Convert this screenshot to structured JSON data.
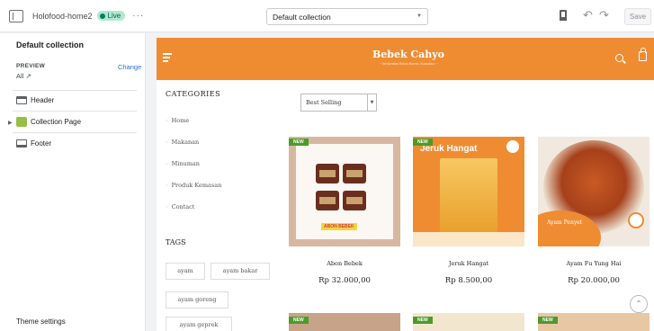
{
  "topbar": {
    "theme_name": "Holofood-home2",
    "live_label": "Live",
    "more": "···",
    "collection_select": "Default collection",
    "save_label": "Save"
  },
  "sidebar": {
    "title": "Default collection",
    "preview_label": "PREVIEW",
    "change_label": "Change",
    "preview_value": "All",
    "items": [
      {
        "label": "Header",
        "icon": "header-section-icon"
      },
      {
        "label": "Collection Page",
        "icon": "collection-page-icon"
      },
      {
        "label": "Footer",
        "icon": "footer-section-icon"
      }
    ],
    "theme_settings": "Theme settings"
  },
  "store": {
    "logo": "Bebek Cahyo",
    "tagline": "~ Kenikmatan Bebek Bumbu Nusantara ~",
    "header_color": "#ef8c32",
    "categories_title": "CATEGORIES",
    "categories": [
      "Home",
      "Makanan",
      "Minuman",
      "Produk Kemasan",
      "Contact"
    ],
    "tags_title": "TAGS",
    "tags": [
      "ayam",
      "ayam bakar",
      "ayam goreng",
      "ayam geprek"
    ],
    "sort_value": "Best Selling",
    "new_badge": "NEW",
    "products": [
      {
        "name": "Abon Bebek",
        "price": "Rp 32.000,00",
        "image_label": "ABON BEBEK"
      },
      {
        "name": "Jeruk Hangat",
        "price": "Rp 8.500,00",
        "image_title": "Jeruk Hangat"
      },
      {
        "name": "Ayam Fu Yung Hai",
        "price": "Rp 20.000,00",
        "image_label": "Ayam Penyet"
      }
    ]
  }
}
